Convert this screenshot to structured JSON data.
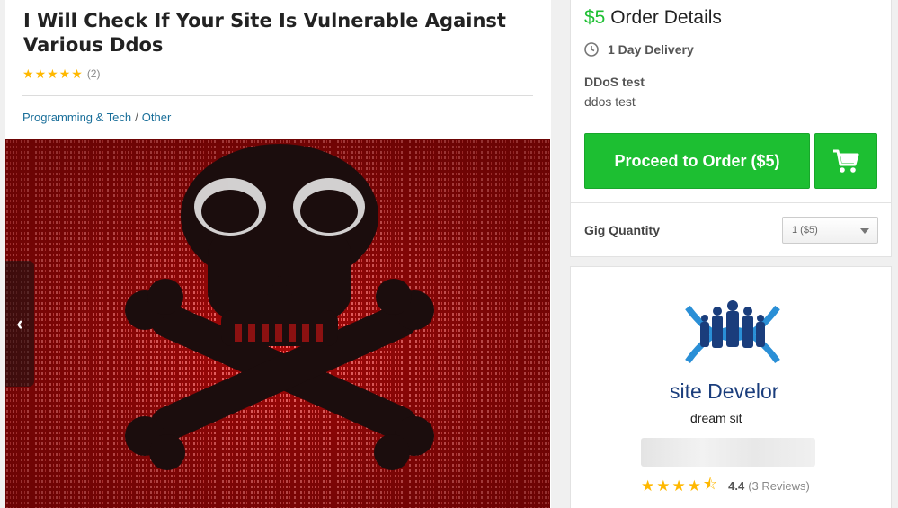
{
  "gig": {
    "title": "I Will Check If Your Site Is Vulnerable Against Various Ddos",
    "rating_count": "(2)",
    "breadcrumb": {
      "category": "Programming & Tech",
      "separator": "/",
      "subcategory": "Other"
    },
    "image_icon": "skull-crossbones-binary-icon"
  },
  "order": {
    "price": "$5",
    "title": "Order Details",
    "delivery": "1 Day Delivery",
    "package_name": "DDoS test",
    "package_desc": "ddos test",
    "proceed_label": "Proceed to Order ($5)",
    "quantity_label": "Gig Quantity",
    "quantity_value": "1 ($5)"
  },
  "seller": {
    "logo_text": "site Develor",
    "logo_tagline": "dream sit",
    "rating": "4.4",
    "reviews": "(3 Reviews)",
    "stars": [
      "★",
      "★",
      "★",
      "★",
      "⯪"
    ]
  },
  "colors": {
    "accent_green": "#1dbf32",
    "star": "#ffb800",
    "link": "#1a6f9a",
    "hero_red": "#b00a0a"
  }
}
